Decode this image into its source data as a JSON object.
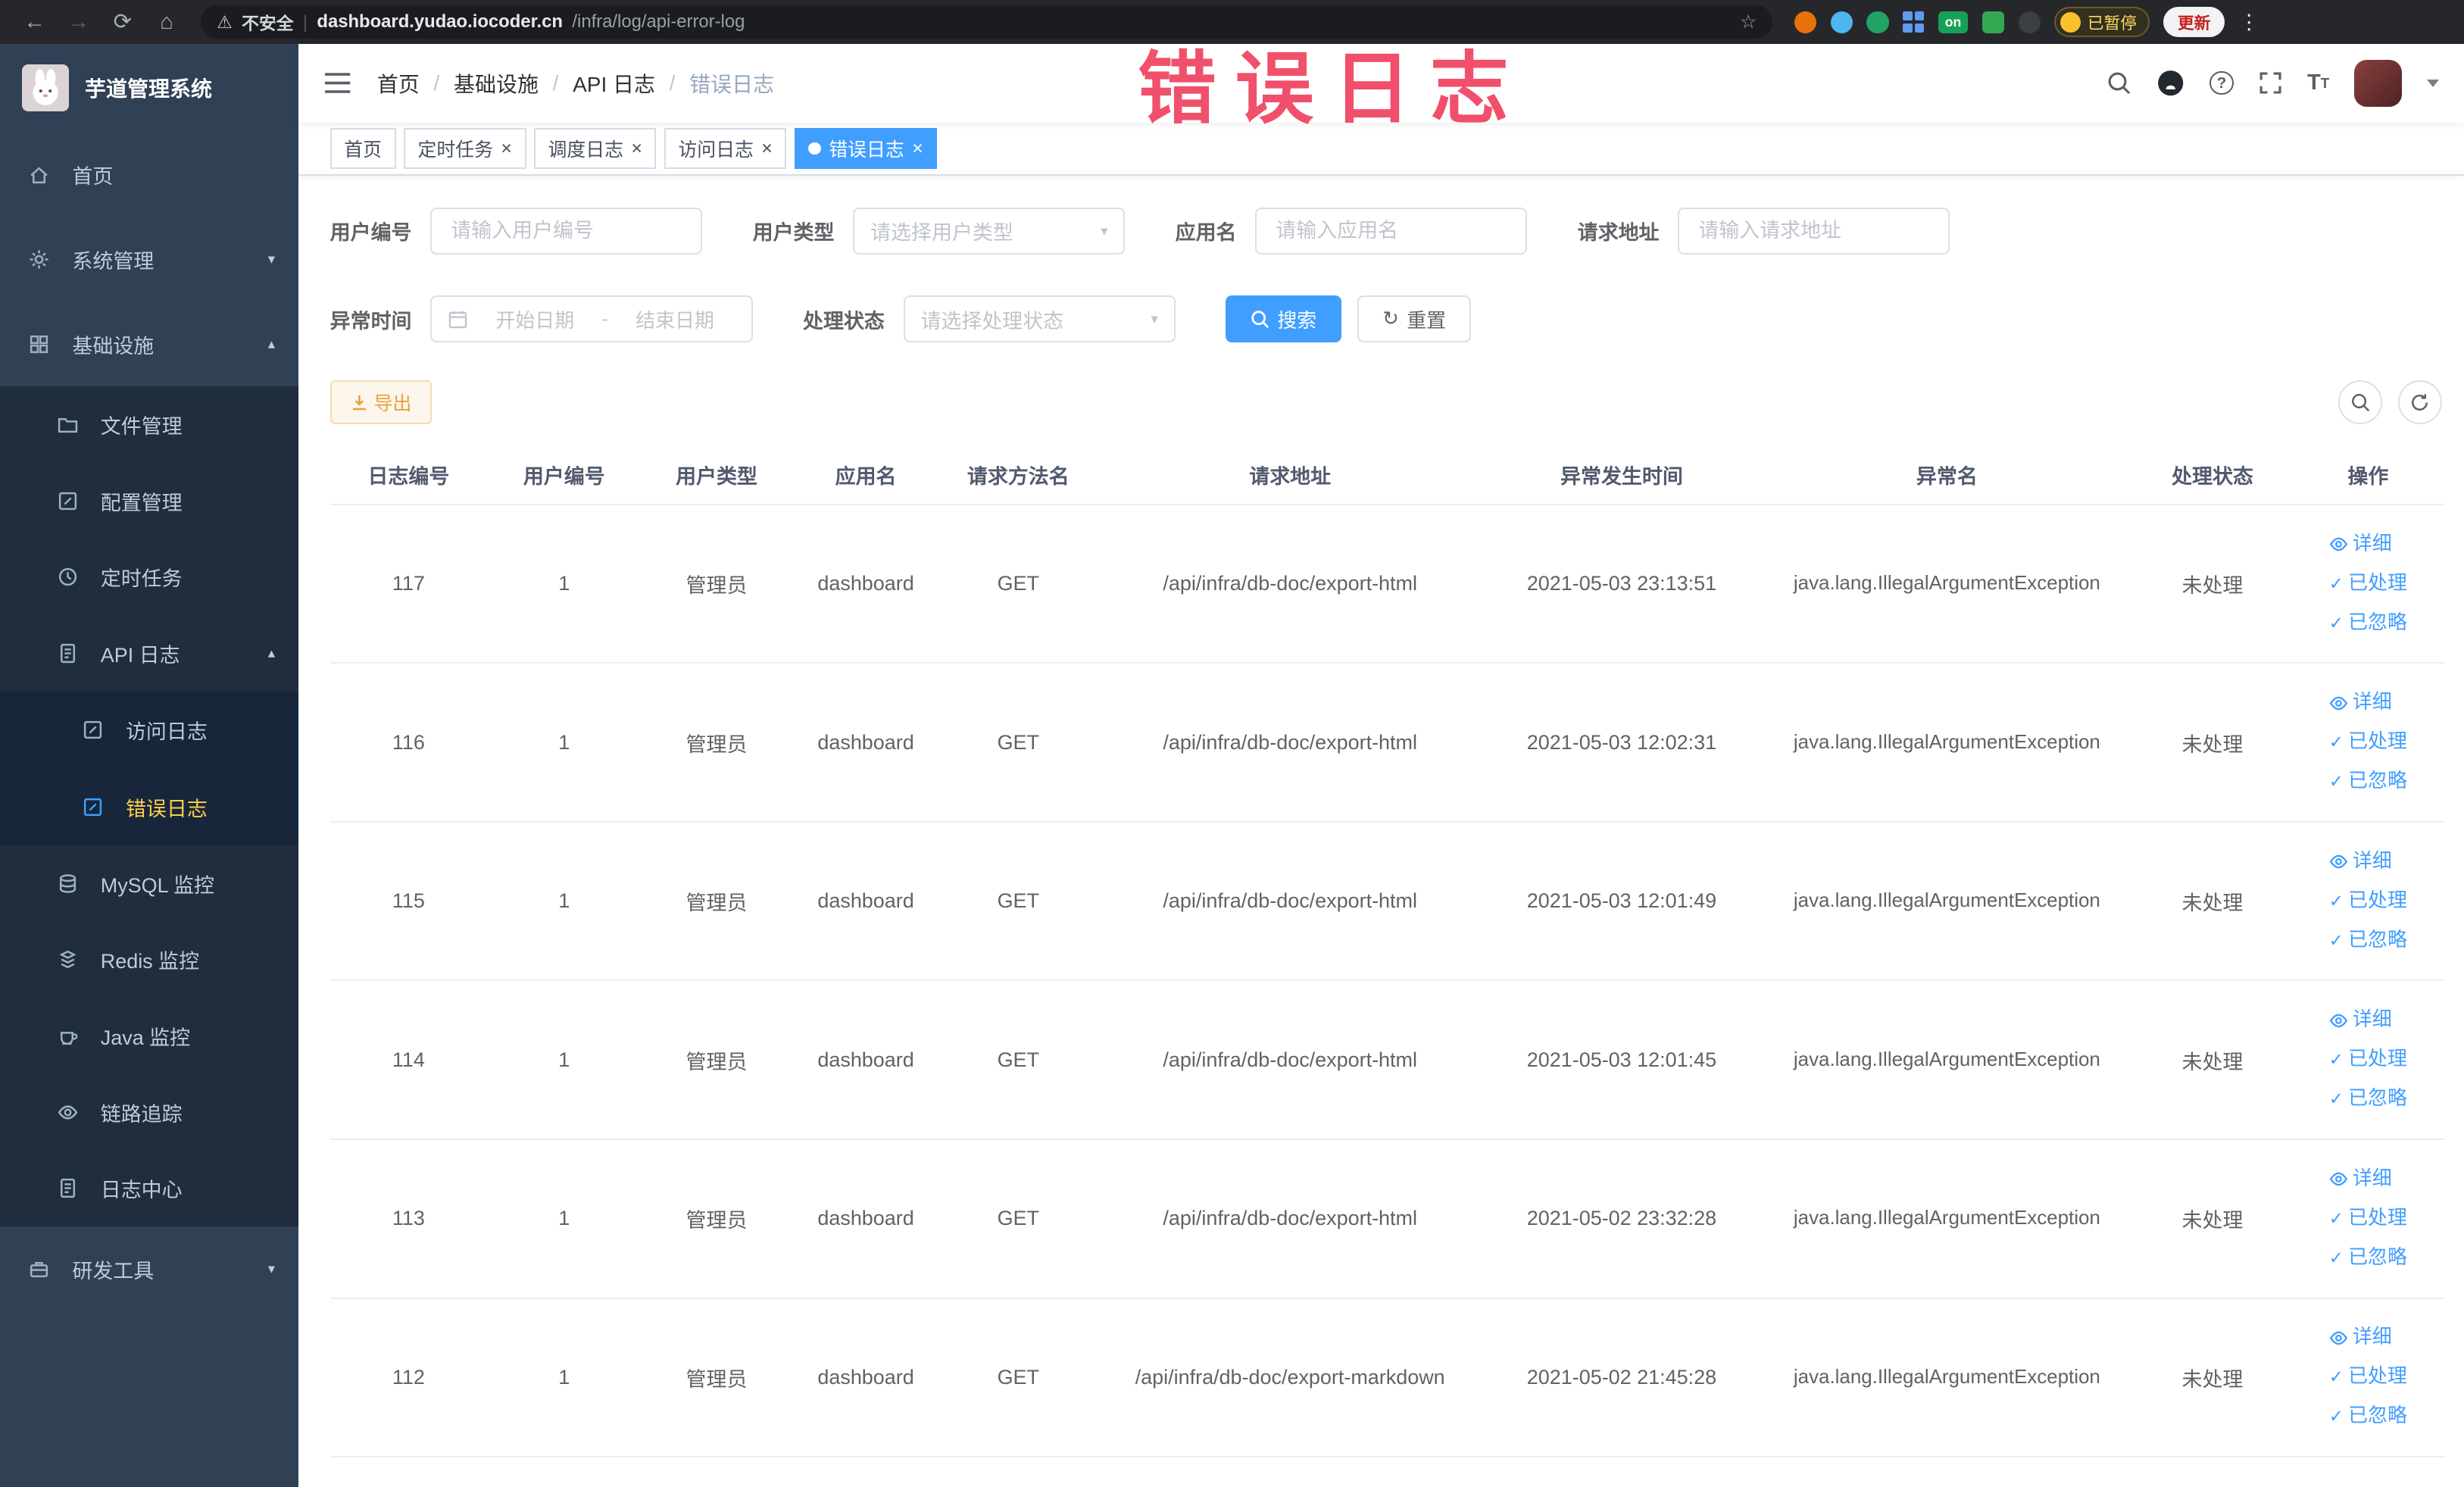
{
  "browser": {
    "security_label": "不安全",
    "url_domain": "dashboard.yudao.iocoder.cn",
    "url_path": "/infra/log/api-error-log",
    "extension_on_badge": "on",
    "paused_badge": "已暂停",
    "update_button": "更新"
  },
  "annotation": {
    "text": "错误日志",
    "color": "#f0506b"
  },
  "colors": {
    "accent": "#409eff",
    "sidebar_bg": "#304156",
    "submenu_bg": "#1f2d3d",
    "active_menu_text": "#ffd04b",
    "warning": "#e6a23c"
  },
  "sidebar": {
    "logo_title": "芋道管理系统",
    "items": [
      {
        "label": "首页"
      },
      {
        "label": "系统管理"
      },
      {
        "label": "基础设施"
      },
      {
        "label": "文件管理"
      },
      {
        "label": "配置管理"
      },
      {
        "label": "定时任务"
      },
      {
        "label": "API 日志"
      },
      {
        "label": "访问日志"
      },
      {
        "label": "错误日志"
      },
      {
        "label": "MySQL 监控"
      },
      {
        "label": "Redis 监控"
      },
      {
        "label": "Java 监控"
      },
      {
        "label": "链路追踪"
      },
      {
        "label": "日志中心"
      },
      {
        "label": "研发工具"
      }
    ]
  },
  "navbar": {
    "breadcrumb": [
      "首页",
      "基础设施",
      "API 日志",
      "错误日志"
    ],
    "separator": "/"
  },
  "tabs": [
    {
      "label": "首页"
    },
    {
      "label": "定时任务"
    },
    {
      "label": "调度日志"
    },
    {
      "label": "访问日志"
    },
    {
      "label": "错误日志"
    }
  ],
  "filters": {
    "user_id": {
      "label": "用户编号",
      "placeholder": "请输入用户编号"
    },
    "user_type": {
      "label": "用户类型",
      "placeholder": "请选择用户类型"
    },
    "app_name": {
      "label": "应用名",
      "placeholder": "请输入应用名"
    },
    "request_url": {
      "label": "请求地址",
      "placeholder": "请输入请求地址"
    },
    "exception_time": {
      "label": "异常时间",
      "start_placeholder": "开始日期",
      "separator": "-",
      "end_placeholder": "结束日期"
    },
    "process_status": {
      "label": "处理状态",
      "placeholder": "请选择处理状态"
    },
    "search_button": "搜索",
    "reset_button": "重置"
  },
  "toolbar": {
    "export_button": "导出"
  },
  "table": {
    "columns": [
      "日志编号",
      "用户编号",
      "用户类型",
      "应用名",
      "请求方法名",
      "请求地址",
      "异常发生时间",
      "异常名",
      "处理状态",
      "操作"
    ],
    "actions": [
      "详细",
      "已处理",
      "已忽略"
    ],
    "rows": [
      {
        "id": "117",
        "user_id": "1",
        "user_type": "管理员",
        "app": "dashboard",
        "method": "GET",
        "url": "/api/infra/db-doc/export-html",
        "time": "2021-05-03 23:13:51",
        "exception": "java.lang.IllegalArgumentException",
        "status": "未处理"
      },
      {
        "id": "116",
        "user_id": "1",
        "user_type": "管理员",
        "app": "dashboard",
        "method": "GET",
        "url": "/api/infra/db-doc/export-html",
        "time": "2021-05-03 12:02:31",
        "exception": "java.lang.IllegalArgumentException",
        "status": "未处理"
      },
      {
        "id": "115",
        "user_id": "1",
        "user_type": "管理员",
        "app": "dashboard",
        "method": "GET",
        "url": "/api/infra/db-doc/export-html",
        "time": "2021-05-03 12:01:49",
        "exception": "java.lang.IllegalArgumentException",
        "status": "未处理"
      },
      {
        "id": "114",
        "user_id": "1",
        "user_type": "管理员",
        "app": "dashboard",
        "method": "GET",
        "url": "/api/infra/db-doc/export-html",
        "time": "2021-05-03 12:01:45",
        "exception": "java.lang.IllegalArgumentException",
        "status": "未处理"
      },
      {
        "id": "113",
        "user_id": "1",
        "user_type": "管理员",
        "app": "dashboard",
        "method": "GET",
        "url": "/api/infra/db-doc/export-html",
        "time": "2021-05-02 23:32:28",
        "exception": "java.lang.IllegalArgumentException",
        "status": "未处理"
      },
      {
        "id": "112",
        "user_id": "1",
        "user_type": "管理员",
        "app": "dashboard",
        "method": "GET",
        "url": "/api/infra/db-doc/export-markdown",
        "time": "2021-05-02 21:45:28",
        "exception": "java.lang.IllegalArgumentException",
        "status": "未处理"
      }
    ]
  }
}
